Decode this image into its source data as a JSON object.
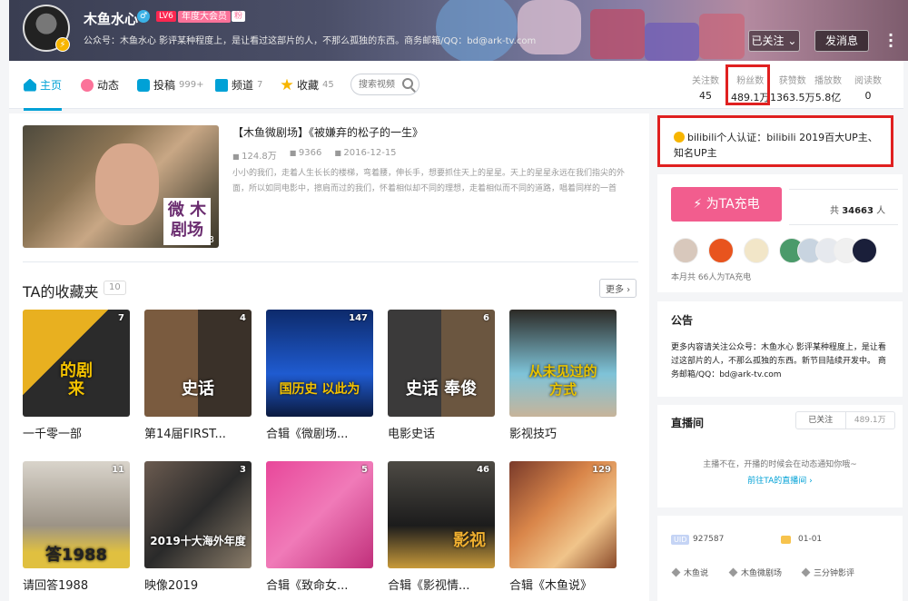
{
  "header": {
    "username": "木鱼水心",
    "gender_icon": "♂",
    "level": "LV6",
    "vip": "年度大会员",
    "fan_tag": "粉",
    "signature": "公众号：木鱼水心 影评某种程度上，是让看过这部片的人，不那么孤独的东西。商务邮箱/QQ：bd@ark-tv.com",
    "follow_button": "已关注",
    "message_button": "发消息"
  },
  "nav": {
    "items": [
      {
        "label": "主页",
        "count": ""
      },
      {
        "label": "动态",
        "count": ""
      },
      {
        "label": "投稿",
        "count": "999+"
      },
      {
        "label": "频道",
        "count": "7"
      },
      {
        "label": "收藏",
        "count": "45"
      }
    ],
    "search_placeholder": "搜索视频"
  },
  "stats": [
    {
      "label": "关注数",
      "value": "45"
    },
    {
      "label": "粉丝数",
      "value": "489.1万"
    },
    {
      "label": "获赞数",
      "value": "1363.5万"
    },
    {
      "label": "播放数",
      "value": "5.8亿"
    },
    {
      "label": "阅读数",
      "value": "0"
    }
  ],
  "featured": {
    "title": "【木鱼微剧场】《被嫌弃的松子的一生》",
    "plays": "124.8万",
    "danmaku": "9366",
    "date": "2016-12-15",
    "duration": "13:23",
    "logo_text": "微木鱼剧场",
    "description": "小小的我们，走着人生长长的楼梯，弯着腰，伸长手，想要抓住天上的星星。天上的星星永远在我们指尖的外面，所以如同电影中，擦肩而过的我们，怀着相似却不同的理想，走着相似而不同的道路，唱着同样的一首"
  },
  "favorites": {
    "title": "TA的收藏夹",
    "count": "10",
    "more": "更多",
    "items": [
      {
        "title": "一千零一部",
        "count": "7",
        "overlay": "的剧\n来"
      },
      {
        "title": "第14届FIRST...",
        "count": "4",
        "overlay": "史话"
      },
      {
        "title": "合辑《微剧场...",
        "count": "147",
        "overlay": "国历史 以此为"
      },
      {
        "title": "电影史话",
        "count": "6",
        "overlay": "史话 奉俊"
      },
      {
        "title": "影视技巧",
        "count": "",
        "overlay": "从未见过的\n方式"
      },
      {
        "title": "请回答1988",
        "count": "11",
        "overlay": "答1988"
      },
      {
        "title": "映像2019",
        "count": "3",
        "overlay": "2019十大海外年度"
      },
      {
        "title": "合辑《致命女...",
        "count": "5",
        "overlay": ""
      },
      {
        "title": "合辑《影视情...",
        "count": "46",
        "overlay": "影视"
      },
      {
        "title": "合辑《木鱼说》",
        "count": "129",
        "overlay": ""
      }
    ]
  },
  "verify": {
    "text": "bilibili个人认证：bilibili 2019百大UP主、知名UP主"
  },
  "charge": {
    "button": "为TA充电",
    "total_prefix": "共",
    "total": "34663",
    "total_suffix": "人",
    "month_text": "本月共 66人为TA充电"
  },
  "notice": {
    "title": "公告",
    "content": "更多内容请关注公众号：木鱼水心 影评某种程度上，是让看过这部片的人，不那么孤独的东西。新节目陆续开发中。 商务邮箱/QQ：bd@ark-tv.com"
  },
  "live": {
    "title": "直播间",
    "follow": "已关注",
    "count": "489.1万",
    "tip": "主播不在，开播的时候会在动态通知你哦~",
    "link": "前往TA的直播间"
  },
  "info": {
    "uid_label": "UID",
    "uid": "927587",
    "birthday": "01-01",
    "tags": [
      "木鱼说",
      "木鱼微剧场",
      "三分钟影评"
    ]
  }
}
